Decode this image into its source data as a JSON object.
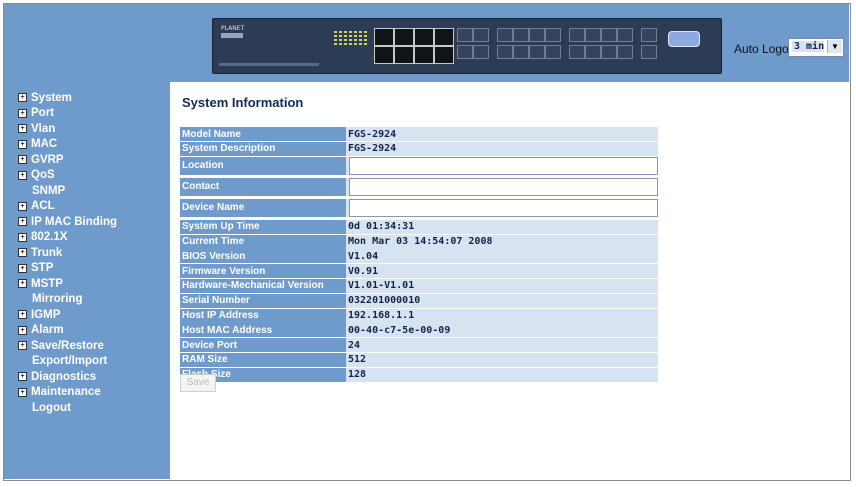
{
  "header": {
    "device_brand": "PLANET",
    "auto_logout_label": "Auto Logout",
    "auto_logout_value": "3 min"
  },
  "sidebar": {
    "items": [
      {
        "label": "System",
        "expandable": true
      },
      {
        "label": "Port",
        "expandable": true
      },
      {
        "label": "Vlan",
        "expandable": true
      },
      {
        "label": "MAC",
        "expandable": true
      },
      {
        "label": "GVRP",
        "expandable": true
      },
      {
        "label": "QoS",
        "expandable": true
      },
      {
        "label": "SNMP",
        "expandable": false
      },
      {
        "label": "ACL",
        "expandable": true
      },
      {
        "label": "IP MAC Binding",
        "expandable": true
      },
      {
        "label": "802.1X",
        "expandable": true
      },
      {
        "label": "Trunk",
        "expandable": true
      },
      {
        "label": "STP",
        "expandable": true
      },
      {
        "label": "MSTP",
        "expandable": true
      },
      {
        "label": "Mirroring",
        "expandable": false
      },
      {
        "label": "IGMP",
        "expandable": true
      },
      {
        "label": "Alarm",
        "expandable": true
      },
      {
        "label": "Save/Restore",
        "expandable": true
      },
      {
        "label": "Export/Import",
        "expandable": false
      },
      {
        "label": "Diagnostics",
        "expandable": true
      },
      {
        "label": "Maintenance",
        "expandable": true
      },
      {
        "label": "Logout",
        "expandable": false
      }
    ]
  },
  "main": {
    "title": "System Information",
    "save_label": "Save",
    "rows": [
      {
        "label": "Model Name",
        "value": "FGS-2924"
      },
      {
        "label": "System Description",
        "value": "FGS-2924"
      },
      {
        "label": "Location",
        "value": ""
      },
      {
        "label": "Contact",
        "value": ""
      },
      {
        "label": "Device Name",
        "value": ""
      },
      {
        "label": "System Up Time",
        "value": "0d 01:34:31"
      },
      {
        "label": "Current Time",
        "value": "Mon Mar 03 14:54:07 2008"
      },
      {
        "label": "BIOS Version",
        "value": "V1.04"
      },
      {
        "label": "Firmware Version",
        "value": "V0.91"
      },
      {
        "label": "Hardware-Mechanical Version",
        "value": "V1.01-V1.01"
      },
      {
        "label": "Serial Number",
        "value": "032201000010"
      },
      {
        "label": "Host IP Address",
        "value": "192.168.1.1"
      },
      {
        "label": "Host MAC Address",
        "value": "00-40-c7-5e-00-09"
      },
      {
        "label": "Device Port",
        "value": "24"
      },
      {
        "label": "RAM Size",
        "value": "512"
      },
      {
        "label": "Flash Size",
        "value": "128"
      }
    ]
  }
}
